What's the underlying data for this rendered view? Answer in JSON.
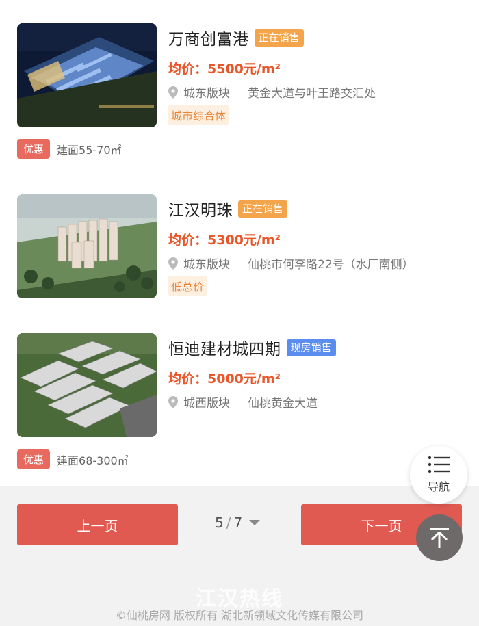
{
  "listings": [
    {
      "title": "万商创富港",
      "status": "正在销售",
      "status_color": "#f4a44a",
      "price": "均价：5500元/m²",
      "district": "城东版块",
      "address": "黄金大道与叶王路交汇处",
      "tag": "城市综合体",
      "promo_badge": "优惠",
      "promo_area": "建面55-70㎡",
      "image": "night-aerial-commercial-complex"
    },
    {
      "title": "江汉明珠",
      "status": "正在销售",
      "status_color": "#f4a44a",
      "price": "均价：5300元/m²",
      "district": "城东版块",
      "address": "仙桃市何李路22号（水厂南侧）",
      "tag": "低总价",
      "image": "aerial-residential-towers"
    },
    {
      "title": "恒迪建材城四期",
      "status": "现房销售",
      "status_color": "#5b8def",
      "price": "均价：5000元/m²",
      "district": "城西版块",
      "address": "仙桃黄金大道",
      "promo_badge": "优惠",
      "promo_area": "建面68-300㎡",
      "image": "aerial-warehouse-market"
    }
  ],
  "nav": {
    "label": "导航",
    "icon": "menu-icon"
  },
  "back_to_top": {
    "icon": "arrow-up-icon"
  },
  "pagination": {
    "prev_label": "上一页",
    "next_label": "下一页",
    "current": "5",
    "separator": "/",
    "total": "7"
  },
  "footer": {
    "watermark": "江汉热线",
    "copyright": "©仙桃房网 版权所有 湖北新领域文化传媒有限公司"
  },
  "colors": {
    "accent": "#e05a52",
    "price": "#e8562a",
    "tag_text": "#e8863a"
  }
}
